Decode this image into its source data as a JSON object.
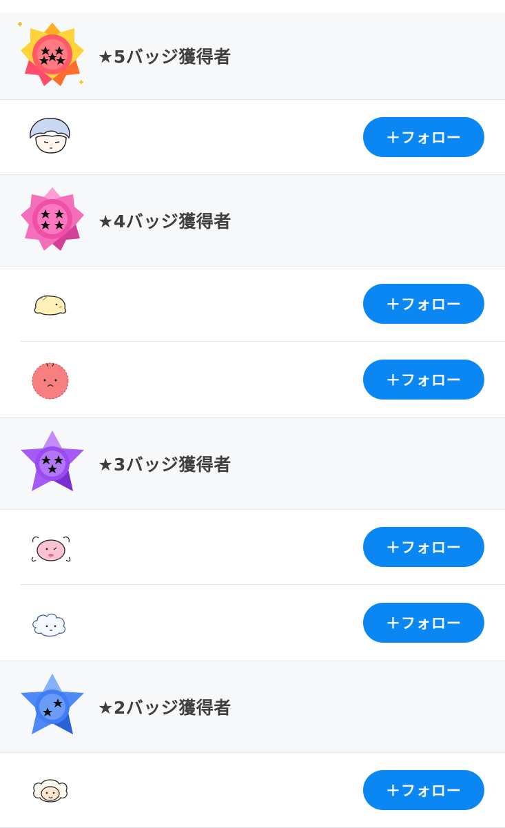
{
  "follow_label": "＋フォロー",
  "groups": [
    {
      "title": "★5バッジ獲得者",
      "badge_icon": "5-star-badge-icon",
      "badge_color": "#ff5a66",
      "users": [
        {
          "avatar": "blue-haired-character-avatar"
        }
      ]
    },
    {
      "title": "★4バッジ獲得者",
      "badge_icon": "4-star-badge-icon",
      "badge_color": "#f04fa8",
      "users": [
        {
          "avatar": "yellow-chick-avatar"
        },
        {
          "avatar": "pink-fluffball-avatar"
        }
      ]
    },
    {
      "title": "★3バッジ獲得者",
      "badge_icon": "3-star-badge-icon",
      "badge_color": "#9a4bef",
      "users": [
        {
          "avatar": "pink-face-avatar"
        },
        {
          "avatar": "cloud-creature-avatar"
        }
      ]
    },
    {
      "title": "★2バッジ獲得者",
      "badge_icon": "2-star-badge-icon",
      "badge_color": "#3f7ef2",
      "users": [
        {
          "avatar": "sheep-avatar"
        }
      ]
    }
  ]
}
